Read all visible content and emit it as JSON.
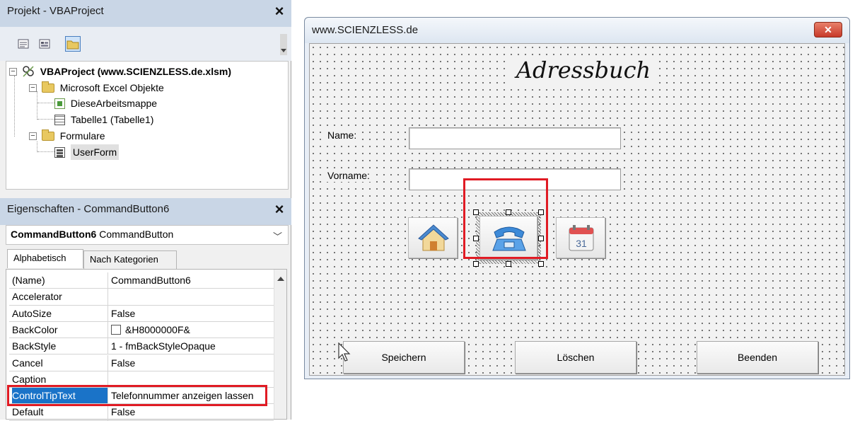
{
  "project_panel": {
    "title": "Projekt - VBAProject",
    "close_symbol": "×",
    "toolbar": [
      "view-code-icon",
      "view-object-icon",
      "toggle-folders-icon"
    ],
    "tree": {
      "root": "VBAProject (www.SCIENZLESS.de.xlsm)",
      "folder1": "Microsoft Excel Objekte",
      "item1": "DieseArbeitsmappe",
      "item2": "Tabelle1 (Tabelle1)",
      "folder2": "Formulare",
      "item3": "UserForm"
    }
  },
  "properties_panel": {
    "title": "Eigenschaften - CommandButton6",
    "close_symbol": "×",
    "object_name": "CommandButton6",
    "object_type": "CommandButton",
    "tabs": [
      "Alphabetisch",
      "Nach Kategorien"
    ],
    "rows": [
      {
        "name": "(Name)",
        "value": "CommandButton6"
      },
      {
        "name": "Accelerator",
        "value": ""
      },
      {
        "name": "AutoSize",
        "value": "False"
      },
      {
        "name": "BackColor",
        "value": "&H8000000F&"
      },
      {
        "name": "BackStyle",
        "value": "1 - fmBackStyleOpaque"
      },
      {
        "name": "Cancel",
        "value": "False"
      },
      {
        "name": "Caption",
        "value": ""
      },
      {
        "name": "ControlTipText",
        "value": "Telefonnummer anzeigen lassen"
      },
      {
        "name": "Default",
        "value": "False"
      }
    ]
  },
  "userform": {
    "window_title": "www.SCIENZLESS.de",
    "close_symbol": "✕",
    "heading": "Adressbuch",
    "name_label": "Name:",
    "vorname_label": "Vorname:",
    "name_value": "",
    "vorname_value": "",
    "icon_buttons": [
      "home-icon",
      "telephone-icon",
      "calendar-icon"
    ],
    "calendar_day": "31",
    "buttons": {
      "save": "Speichern",
      "delete": "Löschen",
      "exit": "Beenden"
    }
  },
  "colors": {
    "highlight_red": "#e01b24",
    "selection_blue": "#1a73c8",
    "panel_title": "#c9d6e6"
  }
}
